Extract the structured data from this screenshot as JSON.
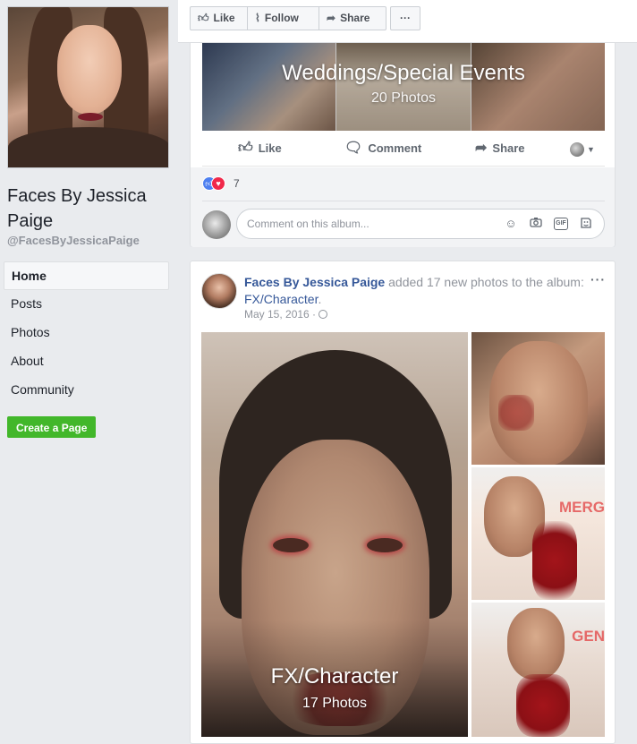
{
  "sidebar": {
    "page_name": "Faces By Jessica Paige",
    "handle": "@FacesByJessicaPaige",
    "nav": [
      {
        "label": "Home",
        "active": true
      },
      {
        "label": "Posts",
        "active": false
      },
      {
        "label": "Photos",
        "active": false
      },
      {
        "label": "About",
        "active": false
      },
      {
        "label": "Community",
        "active": false
      }
    ],
    "create_page_label": "Create a Page"
  },
  "action_bar": {
    "like": "Like",
    "follow": "Follow",
    "share": "Share",
    "more": "···"
  },
  "post1": {
    "album_title": "Weddings/Special Events",
    "album_count": "20 Photos",
    "actions": {
      "like": "Like",
      "comment": "Comment",
      "share": "Share"
    },
    "reaction_count": "7",
    "comment_placeholder": "Comment on this album...",
    "comment_icons": {
      "emoji": "☺",
      "camera": "camera",
      "gif": "GIF",
      "sticker": "sticker"
    }
  },
  "post2": {
    "author": "Faces By Jessica Paige",
    "action_text": " added 17 new photos to the album: ",
    "album_link": "FX/Character",
    "period": ".",
    "date": "May 15, 2016 · ",
    "more": "···",
    "album_title": "FX/Character",
    "album_count": "17 Photos",
    "side_sign_1": "MERG",
    "side_sign_2": "GEN"
  },
  "colors": {
    "link": "#365899",
    "create_button": "#42b72a",
    "background": "#e9ebee"
  }
}
